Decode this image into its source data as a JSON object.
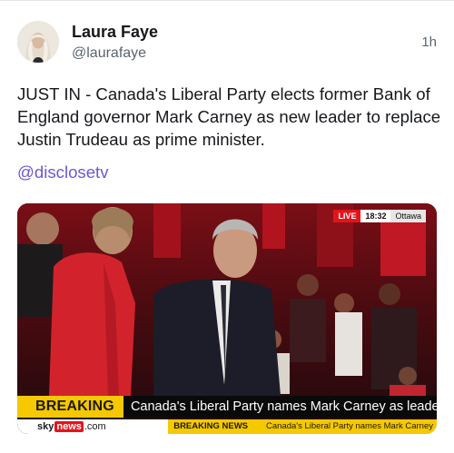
{
  "author": {
    "display_name": "Laura Faye",
    "handle": "@laurafaye",
    "avatar_icon": "avatar-photo"
  },
  "timestamp": "1h",
  "tweet": {
    "text": "JUST IN - Canada's Liberal Party elects former Bank of England governor Mark Carney as new leader to replace Justin Trudeau as prime minister.",
    "mention": "@disclosetv"
  },
  "media": {
    "live_label": "LIVE",
    "live_time": "18:32",
    "location": "Ottawa",
    "breaking_label": "BREAKING NEWS",
    "breaking_headline": "Canada's Liberal Party names Mark Carney as leader",
    "logo": {
      "sky": "sky",
      "news": "news",
      "dotcom": ".com"
    },
    "ticker_label": "BREAKING NEWS",
    "ticker_text": "Canada's Liberal Party names Mark Carney"
  },
  "colors": {
    "mention": "#6b58d6",
    "breaking_yellow": "#f5c800",
    "live_red": "#e4141b"
  }
}
